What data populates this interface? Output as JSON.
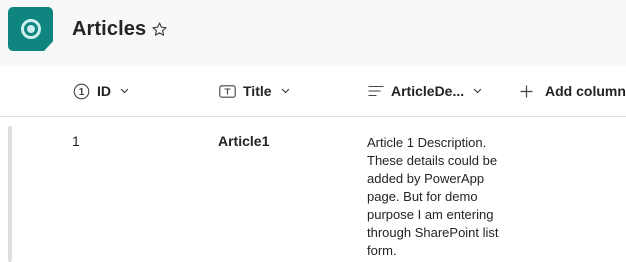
{
  "header": {
    "title": "Articles",
    "app_icon": "list-app-icon",
    "favorite_icon": "star-outline-icon",
    "app_icon_color": "#0f8580"
  },
  "columns": [
    {
      "label": "ID",
      "icon": "number-circle-icon",
      "icon_glyph": "1"
    },
    {
      "label": "Title",
      "icon": "text-field-icon"
    },
    {
      "label": "ArticleDe...",
      "icon": "multiline-text-icon"
    },
    {
      "label": "Add column",
      "icon": "plus-icon"
    }
  ],
  "rows": [
    {
      "id": "1",
      "title": "Article1",
      "description": "Article 1 Description. These details could be added by PowerApp page. But for demo purpose I am entering through SharePoint list form."
    }
  ]
}
